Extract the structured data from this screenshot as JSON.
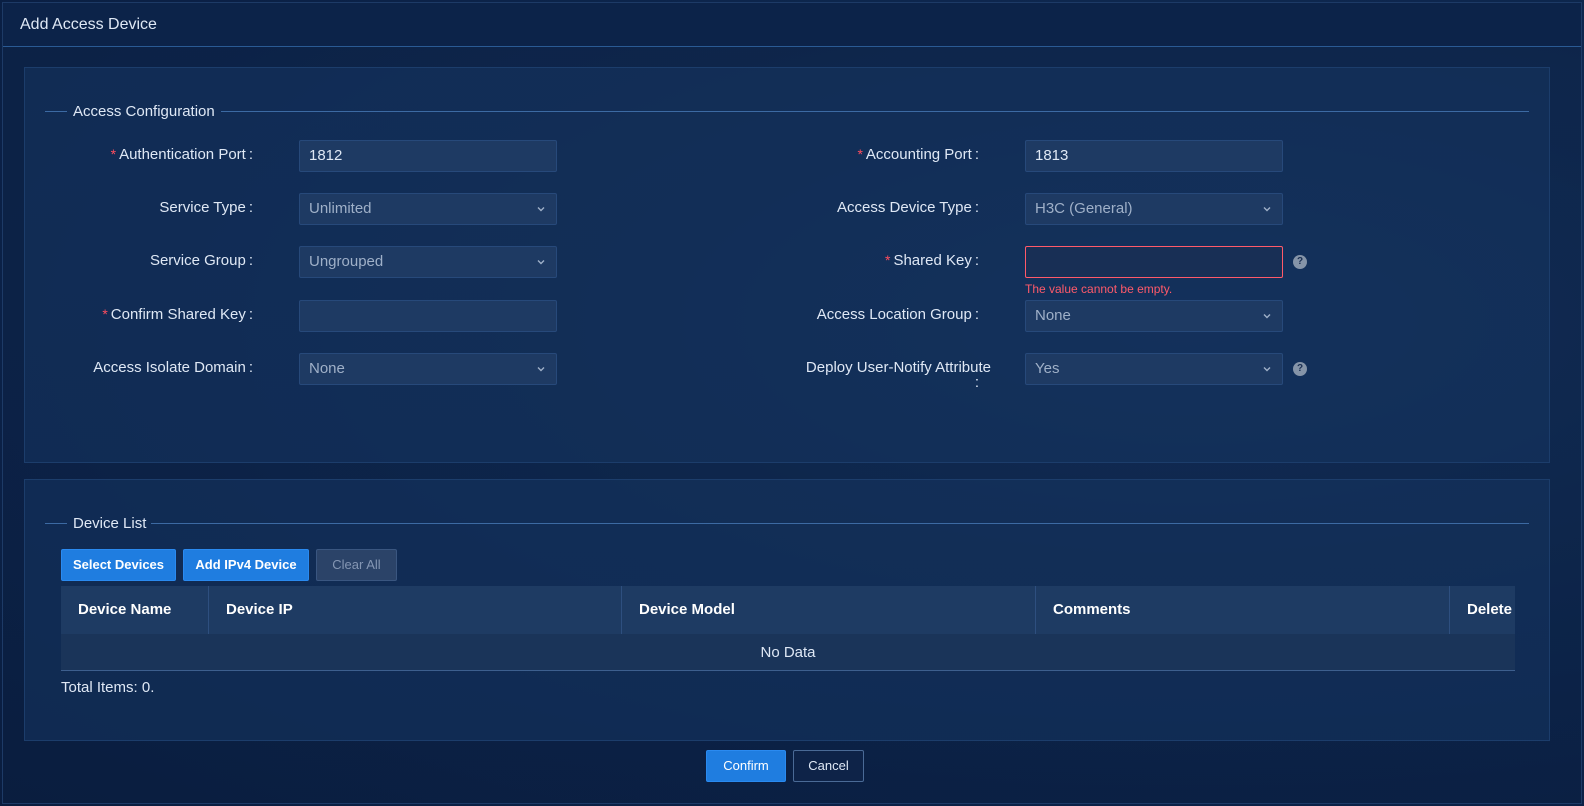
{
  "dialog": {
    "title": "Add Access Device"
  },
  "access_config": {
    "legend": "Access Configuration",
    "fields": {
      "auth_port": {
        "label": "Authentication Port",
        "value": "1812",
        "required": true
      },
      "acct_port": {
        "label": "Accounting Port",
        "value": "1813",
        "required": true
      },
      "service_type": {
        "label": "Service Type",
        "value": "Unlimited"
      },
      "device_type": {
        "label": "Access Device Type",
        "value": "H3C (General)"
      },
      "service_group": {
        "label": "Service Group",
        "value": "Ungrouped"
      },
      "shared_key": {
        "label": "Shared Key",
        "value": "",
        "required": true,
        "error": "The value cannot be empty."
      },
      "confirm_key": {
        "label": "Confirm Shared Key",
        "value": "",
        "required": true
      },
      "location_group": {
        "label": "Access Location Group",
        "value": "None"
      },
      "isolate_domain": {
        "label": "Access Isolate Domain",
        "value": "None"
      },
      "notify_attr": {
        "label": "Deploy User-Notify Attribute",
        "value": "Yes"
      }
    },
    "required_mark": "*",
    "colon": ":"
  },
  "device_list": {
    "legend": "Device List",
    "buttons": {
      "select": "Select Devices",
      "add_ipv4": "Add IPv4 Device",
      "clear_all": "Clear All"
    },
    "columns": [
      "Device Name",
      "Device IP",
      "Device Model",
      "Comments",
      "Delete"
    ],
    "empty_text": "No Data",
    "total": "Total Items: 0."
  },
  "footer": {
    "confirm": "Confirm",
    "cancel": "Cancel"
  },
  "colors": {
    "accent": "#1f7de0",
    "error": "#ff5a6a",
    "required": "#ff4d5e"
  },
  "icons": {
    "dropdown": "chevron-down-icon",
    "help": "help-circle-icon"
  },
  "help_glyph": "?"
}
